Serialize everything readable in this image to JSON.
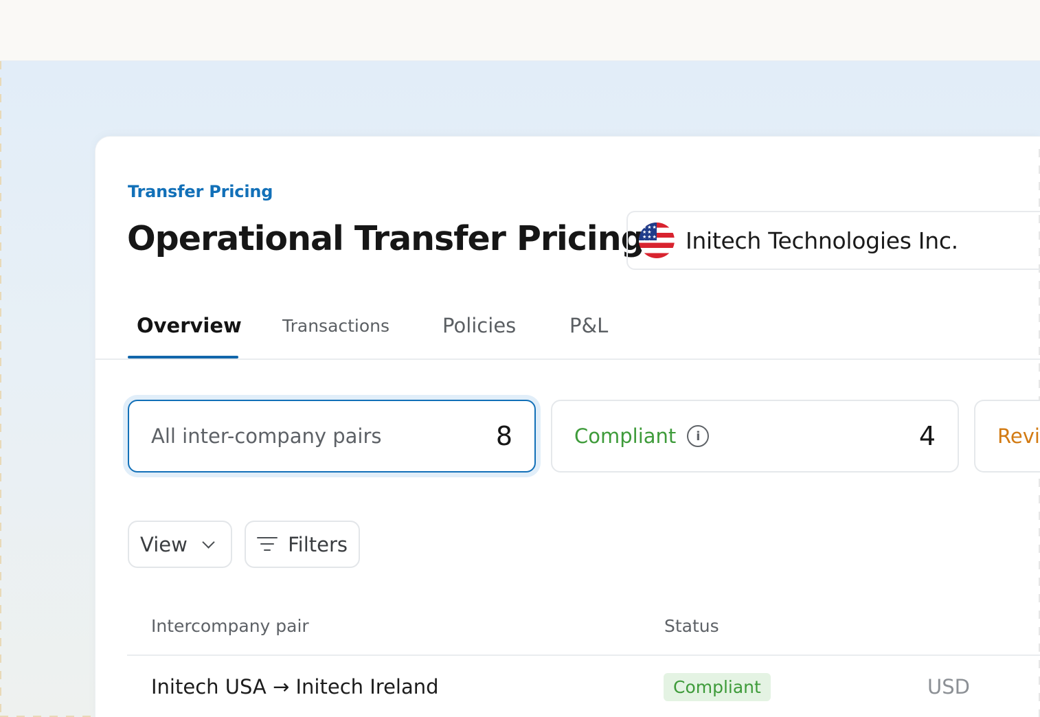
{
  "breadcrumb": "Transfer Pricing",
  "page_title": "Operational Transfer Pricing",
  "entity": {
    "name": "Initech Technologies Inc.",
    "flag_icon": "us-flag-icon"
  },
  "tabs": [
    "Overview",
    "Transactions",
    "Policies",
    "P&L"
  ],
  "active_tab": "Overview",
  "stats": [
    {
      "label": "All inter-company pairs",
      "count": "8",
      "selected": true
    },
    {
      "label": "Compliant",
      "count": "4",
      "color": "#3e9b3a"
    },
    {
      "label": "Revi",
      "color": "#d27a12"
    }
  ],
  "toolbar": {
    "view_label": "View",
    "filters_label": "Filters"
  },
  "table": {
    "headers": [
      "Intercompany pair",
      "Status"
    ],
    "rows": [
      {
        "pair": "Initech USA → Initech Ireland",
        "status": "Compliant",
        "currency": "USD"
      }
    ]
  },
  "colors": {
    "accent": "#1270b8",
    "compliant": "#3e9b3a",
    "review": "#d27a12"
  }
}
